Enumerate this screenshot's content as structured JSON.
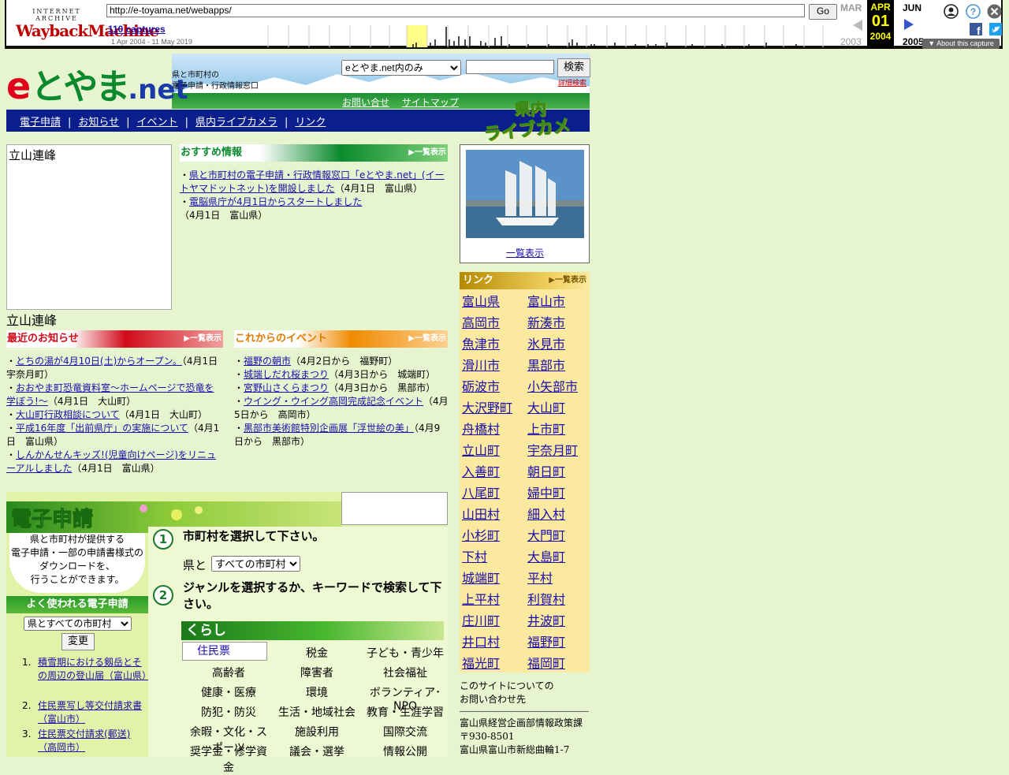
{
  "wayback": {
    "logo_top": "INTERNET ARCHIVE",
    "logo_main": "WaybackMachine",
    "url": "http://e-toyama.net/webapps/",
    "go": "Go",
    "captures": "110 captures",
    "range": "1 Apr 2004 - 11 May 2019",
    "prev_month": "MAR",
    "cur_month": "APR",
    "cur_day": "01",
    "cur_year": "2004",
    "next_month": "JUN",
    "prev_year": "2003",
    "next_year": "2005",
    "about": "▼ About this capture",
    "colors": {
      "highlight": "#ffff00",
      "current_bg": "#000000"
    },
    "icons": [
      "prev-arrow-icon",
      "next-arrow-icon",
      "user-icon",
      "help-icon",
      "close-icon",
      "facebook-icon",
      "twitter-icon"
    ]
  },
  "site": {
    "logo_e": "e",
    "logo_toyama": "とやま",
    "logo_net": ".net",
    "tagline1": "県と市町村の",
    "tagline2": "電子申請・行政情報窓口",
    "search_scope": "eとやま.net内のみ",
    "search_btn": "検索",
    "advanced": "詳細検索",
    "contact_link": "お問い合せ",
    "sitemap_link": "サイトマップ",
    "nav": [
      "電子申請",
      "お知らせ",
      "イベント",
      "県内ライブカメラ",
      "リンク"
    ],
    "livecam1": "県内",
    "livecam2": "ライブカメラ"
  },
  "photo": {
    "alt": "立山連峰",
    "caption": "立山連峰"
  },
  "recommend": {
    "title": "おすすめ情報",
    "more": "▶一覧表示",
    "items": [
      {
        "link": "県と市町村の電子申請・行政情報窓口「eとやま.net」(イートヤマドットネット)を開設しました",
        "meta": "（4月1日　富山県）"
      },
      {
        "link": "電脳県庁が4月1日からスタートしました",
        "meta": "（4月1日　富山県）"
      }
    ]
  },
  "news": {
    "title": "最近のお知らせ",
    "more": "▶一覧表示",
    "items": [
      {
        "link": "とちの湯が4月10日(土)からオープン。",
        "meta": "（4月1日　宇奈月町）"
      },
      {
        "link": "おおやま町恐竜資料室～ホームページで恐竜を学ぼう!～",
        "meta": "（4月1日　大山町）"
      },
      {
        "link": "大山町行政相談について",
        "meta": "（4月1日　大山町）"
      },
      {
        "link": "平成16年度「出前県庁」の実施について",
        "meta": "（4月1日　富山県）"
      },
      {
        "link": "しんかんせんキッズ!(児童向けページ)をリニューアルしました",
        "meta": "（4月1日　富山県）"
      }
    ]
  },
  "events": {
    "title": "これからのイベント",
    "more": "▶一覧表示",
    "items": [
      {
        "link": "福野の朝市",
        "meta": "（4月2日から　福野町）"
      },
      {
        "link": "城端しだれ桜まつり",
        "meta": "（4月3日から　城端町）"
      },
      {
        "link": "宮野山さくらまつり",
        "meta": "（4月3日から　黒部市）"
      },
      {
        "link": "ウイング・ウイング高岡完成記念イベント",
        "meta": "（4月5日から　高岡市）"
      },
      {
        "link": "黒部市美術館特別企画展「浮世絵の美」",
        "meta": "（4月9日から　黒部市）"
      }
    ]
  },
  "livecam_box": {
    "more": "一覧表示"
  },
  "links": {
    "title": "リンク",
    "more": "▶一覧表示",
    "items": [
      "富山県",
      "富山市",
      "高岡市",
      "新湊市",
      "魚津市",
      "氷見市",
      "滑川市",
      "黒部市",
      "砺波市",
      "小矢部市",
      "大沢野町",
      "大山町",
      "舟橋村",
      "上市町",
      "立山町",
      "宇奈月町",
      "入善町",
      "朝日町",
      "八尾町",
      "婦中町",
      "山田村",
      "細入村",
      "小杉町",
      "大門町",
      "下村",
      "大島町",
      "城端町",
      "平村",
      "上平村",
      "利賀村",
      "庄川町",
      "井波町",
      "井口村",
      "福野町",
      "福光町",
      "福岡町"
    ]
  },
  "contact": {
    "line1": "このサイトについての",
    "line2": "お問い合わせ先",
    "dept": "富山県経営企画部情報政策課",
    "zip": "〒930-8501",
    "addr": "富山県富山市新総曲輪1-7"
  },
  "eshinsei": {
    "title": "電子申請",
    "bubble": [
      "県と市町村が提供する",
      "電子申請・一部の申請書様式の",
      "ダウンロードを、",
      "行うことができます。"
    ],
    "freq_title": "よく使われる電子申請",
    "freq_select": "県とすべての市町村",
    "change": "変更",
    "freq_items": [
      "積雪期における剱岳とその周辺の登山届（富山県）",
      "住民票写し等交付請求書（富山市）",
      "住民票交付請求(郵送)（高岡市）"
    ],
    "step1_num": "1",
    "step1": "市町村を選択して下さい。",
    "pref_label": "県と",
    "muni_select": "すべての市町村",
    "step2_num": "2",
    "step2": "ジャンルを選択するか、キーワードで検索して下さい。",
    "kurashi": "くらし",
    "cat_img_alt": "住民票",
    "categories": [
      "税金",
      "子ども・青少年",
      "高齢者",
      "障害者",
      "社会福祉",
      "健康・医療",
      "環境",
      "ボランティア･NPO",
      "防犯・防災",
      "生活・地域社会",
      "教育・生涯学習",
      "余暇・文化・スポーツ",
      "施設利用",
      "国際交流",
      "奨学金・修学資金",
      "議会・選挙",
      "情報公開"
    ]
  }
}
